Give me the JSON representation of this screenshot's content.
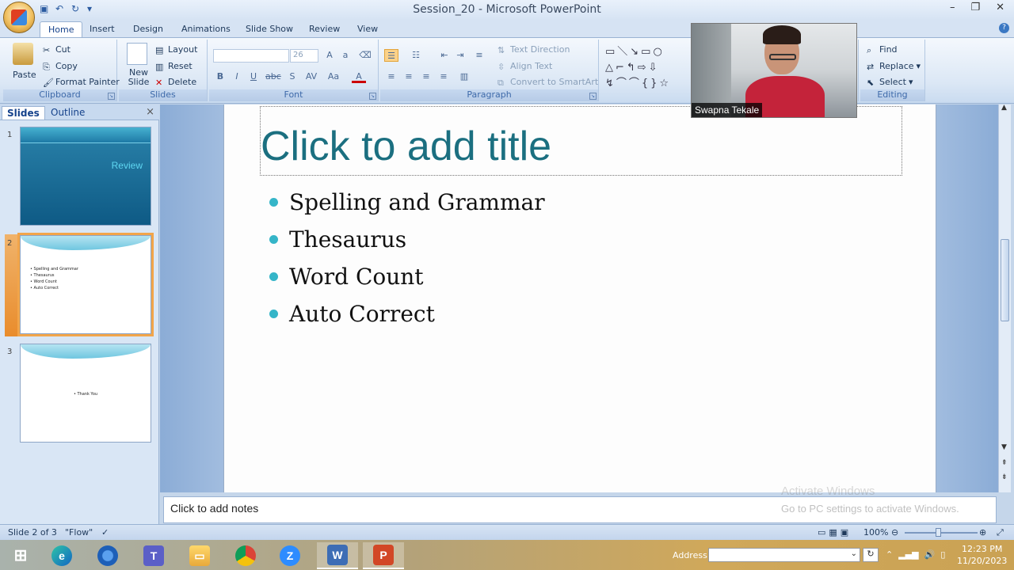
{
  "window": {
    "title": "Session_20 - Microsoft PowerPoint",
    "controls": [
      "–",
      "❐",
      "✕"
    ]
  },
  "ribbon": {
    "tabs": [
      "Home",
      "Insert",
      "Design",
      "Animations",
      "Slide Show",
      "Review",
      "View"
    ],
    "active_tab": "Home",
    "clipboard": {
      "label": "Clipboard",
      "paste": "Paste",
      "cut": "Cut",
      "copy": "Copy",
      "format_painter": "Format Painter"
    },
    "slides": {
      "label": "Slides",
      "new_slide": "New Slide",
      "layout": "Layout",
      "reset": "Reset",
      "delete": "Delete"
    },
    "font": {
      "label": "Font",
      "font_name": "",
      "font_size": "26"
    },
    "paragraph": {
      "label": "Paragraph",
      "text_direction": "Text Direction",
      "align_text": "Align Text",
      "convert_smartart": "Convert to SmartArt"
    },
    "editing": {
      "label": "Editing",
      "find": "Find",
      "replace": "Replace",
      "select": "Select"
    }
  },
  "slides_pane": {
    "tabs": [
      "Slides",
      "Outline"
    ],
    "active_tab": "Slides",
    "thumbnails": [
      {
        "number": "1",
        "text": "Review"
      },
      {
        "number": "2",
        "bullets": [
          "Spelling and Grammar",
          "Thesaurus",
          "Word Count",
          "Auto Correct"
        ]
      },
      {
        "number": "3",
        "text": "Thank You"
      }
    ],
    "selected": "2"
  },
  "slide": {
    "title_placeholder": "Click to add title",
    "bullets": [
      "Spelling and Grammar",
      "Thesaurus",
      "Word Count",
      "Auto Correct"
    ],
    "bullet_color": "#35b5c8",
    "title_color": "#1b6f80"
  },
  "notes": {
    "placeholder": "Click to add notes"
  },
  "watermark": {
    "line1": "Activate Windows",
    "line2": "Go to PC settings to activate Windows."
  },
  "status_bar": {
    "slide_info": "Slide 2 of 3",
    "theme": "\"Flow\"",
    "zoom": "100%"
  },
  "webcam": {
    "name": "Swapna Tekale"
  },
  "taskbar": {
    "address_label": "Address",
    "time": "12:23 PM",
    "date": "11/20/2023",
    "apps": [
      "windows-start",
      "edge",
      "chrome-old",
      "teams",
      "file-explorer",
      "chrome",
      "zoom",
      "word-doc",
      "powerpoint"
    ]
  }
}
